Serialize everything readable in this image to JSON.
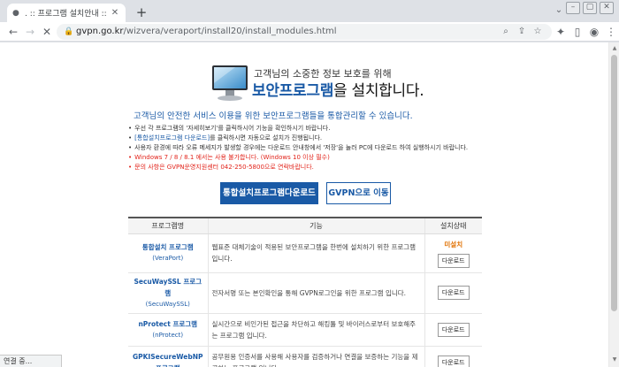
{
  "browser": {
    "tab_title": ". :: 프로그램 설치안내 ::",
    "new_tab_label": "+",
    "url_host": "gvpn.go.kr",
    "url_path": "/wizvera/veraport/install20/install_modules.html",
    "status_text": "연결 중..."
  },
  "page": {
    "headline_sub": "고객님의 소중한 정보 보호를 위해",
    "headline_highlight": "보안프로그램",
    "headline_rest": "을 설치합니다.",
    "lead": "고객님의 안전한 서비스 이용을 위한 보안프로그램들을 통합관리할 수 있습니다.",
    "notes": [
      {
        "bullet": "•",
        "text": "우선 각 프로그램의 '자세히보기'를 클릭하시어 기능을 확인하시기 바랍니다."
      },
      {
        "bullet": "•",
        "link": "[통합설치프로그램 다운로드]",
        "text": "를 클릭하시면 자동으로 설치가 진행됩니다."
      },
      {
        "bullet": "•",
        "text": "사용자 환경에 따라 오류 메세지가 발생할 경우에는 다운로드 안내창에서 '저장'을 눌러 PC에 다운로드 하여 실행하시기 바랍니다."
      },
      {
        "bullet": "•",
        "text": "Windows 7 / 8 / 8.1 에서는 사용 불가합니다. (Windows 10 이상 필수)"
      },
      {
        "bullet": "•",
        "text": "문의 사항은 GVPN운영지원센터 042-250-5800으로 연락바랍니다."
      }
    ],
    "btn_download_all": "통합설치프로그램다운로드",
    "btn_goto_gvpn": "GVPN으로 이동"
  },
  "table": {
    "headers": [
      "프로그램명",
      "기능",
      "설치상태"
    ],
    "rows": [
      {
        "name": "통합설치 프로그램",
        "id": "(VeraPort)",
        "desc": "웹표준 대체기술이 적용된 보안프로그램을 한번에 설치하기 위한 프로그램입니다.",
        "status": "미설치",
        "button": "다운로드"
      },
      {
        "name": "SecuWaySSL 프로그램",
        "id": "(SecuWaySSL)",
        "desc": "전자서명 또는 본인확인을 통해 GVPN로그인을 위한 프로그램 입니다.",
        "status": "",
        "button": "다운로드"
      },
      {
        "name": "nProtect 프로그램",
        "id": "(nProtect)",
        "desc": "실시간으로 비인가된 접근을 차단하고 해킹툴 및 바이러스로부터 보호해주는 프로그램 입니다.",
        "status": "",
        "button": "다운로드"
      },
      {
        "name": "GPKISecureWebNP 프로그램",
        "id": "",
        "desc": "공무원용 인증서를 사용해 사용자를 검증하거나 연결을 보증하는 기능을 제공하는 프로그램 입니다.",
        "status": "",
        "button": "다운로드"
      }
    ]
  },
  "colors": {
    "accent": "#1a5aa6",
    "warning": "#e2231a",
    "status_uninstalled": "#e07000"
  }
}
